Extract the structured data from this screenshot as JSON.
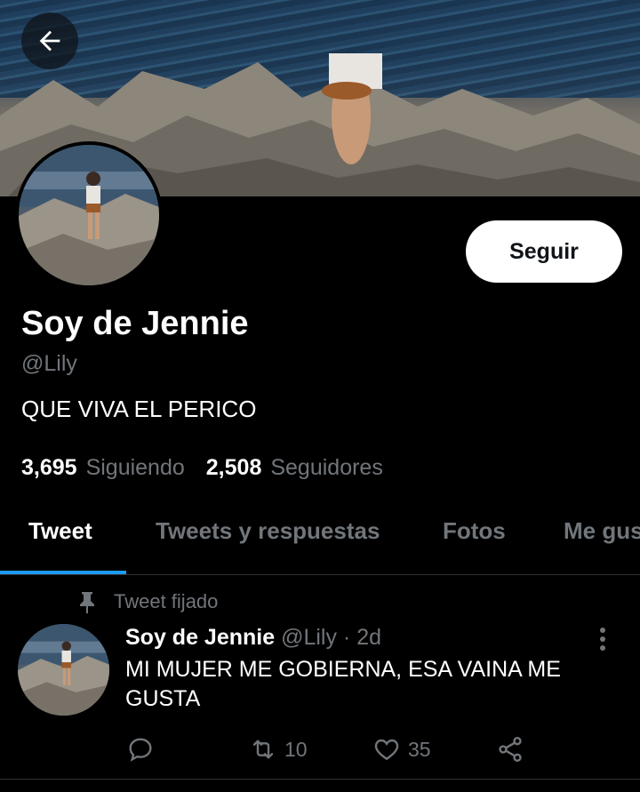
{
  "header": {
    "back_icon": "arrow-left-icon"
  },
  "profile": {
    "follow_label": "Seguir",
    "display_name": "Soy de Jennie",
    "handle": "@Lily",
    "bio": "QUE VIVA EL PERICO",
    "following_count": "3,695",
    "following_label": "Siguiendo",
    "followers_count": "2,508",
    "followers_label": "Seguidores"
  },
  "tabs": [
    {
      "label": "Tweet",
      "active": true
    },
    {
      "label": "Tweets y respuestas",
      "active": false
    },
    {
      "label": "Fotos",
      "active": false
    },
    {
      "label": "Me gus",
      "active": false
    }
  ],
  "pinned_tweet": {
    "pinned_label": "Tweet fijado",
    "author_name": "Soy de Jennie",
    "author_handle": "@Lily",
    "separator": "·",
    "time": "2d",
    "text": "MI MUJER ME GOBIERNA, ESA VAINA ME GUSTA",
    "retweets": "10",
    "likes": "35"
  },
  "colors": {
    "accent": "#1d9bf0",
    "muted": "#71767b",
    "background": "#000000"
  }
}
